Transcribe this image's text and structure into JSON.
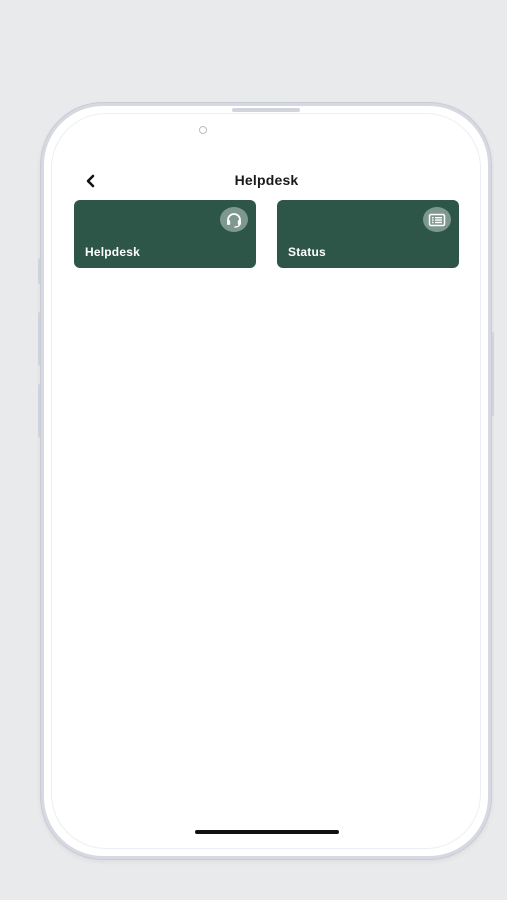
{
  "header": {
    "title": "Helpdesk",
    "back_icon": "chevron-left-icon"
  },
  "tiles": [
    {
      "label": "Helpdesk",
      "icon": "headset-icon"
    },
    {
      "label": "Status",
      "icon": "list-icon"
    }
  ],
  "colors": {
    "tile_background": "#2e5648",
    "tile_icon_background": "#7e9890",
    "page_background": "#ffffff",
    "outer_background": "#e9eaec"
  }
}
